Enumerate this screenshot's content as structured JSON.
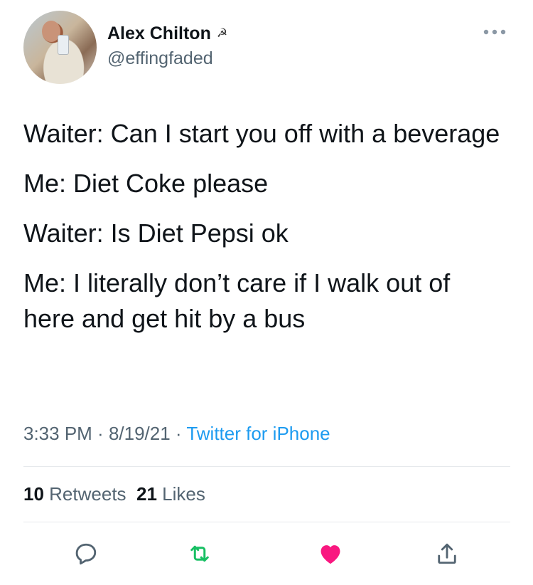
{
  "author": {
    "name": "Alex Chilton",
    "name_emoji": "☭",
    "handle": "@effingfaded",
    "avatar_icon": "profile-photo"
  },
  "menu_icon": "more-dots-icon",
  "tweet": {
    "lines": [
      "Waiter: Can I start you off with a beverage",
      "Me: Diet Coke please",
      "Waiter: Is Diet Pepsi ok",
      "Me: I literally don’t care if I walk out of here and get hit by a bus"
    ]
  },
  "meta": {
    "time": "3:33 PM",
    "sep1": " · ",
    "date": "8/19/21",
    "sep2": " · ",
    "source": "Twitter for iPhone"
  },
  "stats": {
    "retweets_count": "10",
    "retweets_label": "Retweets",
    "likes_count": "21",
    "likes_label": "Likes"
  },
  "actions": [
    {
      "icon": "reply-icon"
    },
    {
      "icon": "retweet-icon",
      "color": "#17bf63"
    },
    {
      "icon": "heart-icon",
      "color": "#f91880",
      "state": "liked"
    },
    {
      "icon": "share-icon"
    }
  ],
  "colors": {
    "text": "#0f1419",
    "secondary": "#536471",
    "link": "#1d9bf0",
    "divider": "#e6e9ec"
  }
}
